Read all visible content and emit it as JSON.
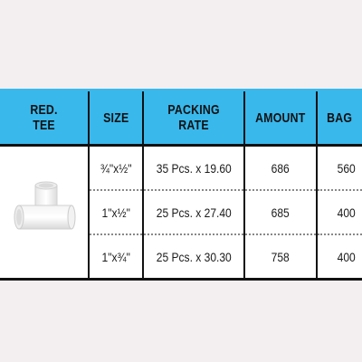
{
  "table": {
    "headers": [
      "RED.\nTEE",
      "SIZE",
      "PACKING\nRATE",
      "AMOUNT",
      "BAG"
    ],
    "product_image": "reducing-tee-pipe-fitting",
    "rows": [
      {
        "size": "¾\"x½\"",
        "packing_rate": "35 Pcs. x 19.60",
        "amount": "686",
        "bag": "560"
      },
      {
        "size": "1\"x½\"",
        "packing_rate": "25 Pcs. x 27.40",
        "amount": "685",
        "bag": "400"
      },
      {
        "size": "1\"x¾\"",
        "packing_rate": "25 Pcs. x 30.30",
        "amount": "758",
        "bag": "400"
      }
    ]
  },
  "colors": {
    "background": "#f3eef0",
    "header_bg": "#39b8ec",
    "border": "#111111"
  }
}
